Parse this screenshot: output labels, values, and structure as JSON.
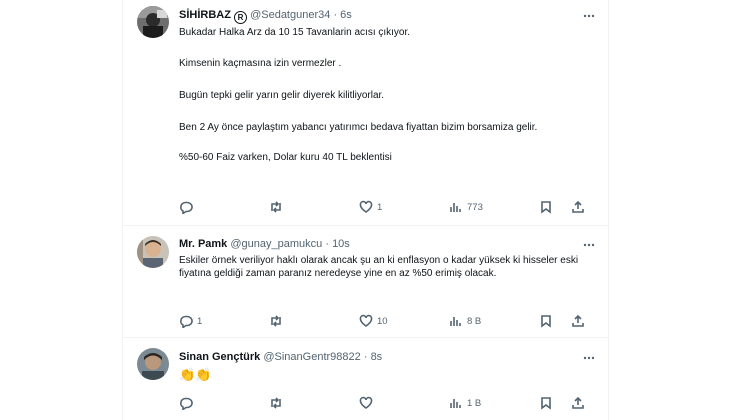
{
  "tweets": [
    {
      "name": "SİHİRBAZ",
      "badge": "R",
      "handle": "@Sedatguner34",
      "sep": "·",
      "time": "6s",
      "lines": [
        "Bukadar Halka Arz da 10 15 Tavanlarin acısı çıkıyor.",
        "Kimsenin kaçmasına izin vermezler .",
        "Bugün tepki gelir yarın gelir diyerek kilitliyorlar.",
        "Ben 2 Ay önce paylaştım yabancı yatırımcı bedava fiyattan bizim borsamiza gelir.",
        "%50-60 Faiz varken, Dolar kuru 40 TL beklentisi"
      ],
      "reply_count": "",
      "retweet_count": "",
      "like_count": "1",
      "view_count": "773"
    },
    {
      "name": "Mr. Pamk",
      "handle": "@gunay_pamukcu",
      "sep": "·",
      "time": "10s",
      "text": "Eskiler örnek veriliyor haklı olarak ancak şu an ki enflasyon o kadar yüksek ki hisseler eski fiyatına geldiği zaman paranız neredeyse yine en az %50 erimiş olacak.",
      "reply_count": "1",
      "retweet_count": "",
      "like_count": "10",
      "view_count": "8 B"
    },
    {
      "name": "Sinan Gençtürk",
      "handle": "@SinanGentr98822",
      "sep": "·",
      "time": "8s",
      "text": "👏👏",
      "reply_count": "",
      "retweet_count": "",
      "like_count": "",
      "view_count": "1 B"
    }
  ],
  "colors": {
    "text": "#0f1419",
    "secondary": "#536471",
    "border": "#eff3f4"
  },
  "icons": [
    "more-icon",
    "reply-icon",
    "retweet-icon",
    "like-icon",
    "views-icon",
    "bookmark-icon",
    "share-icon"
  ]
}
